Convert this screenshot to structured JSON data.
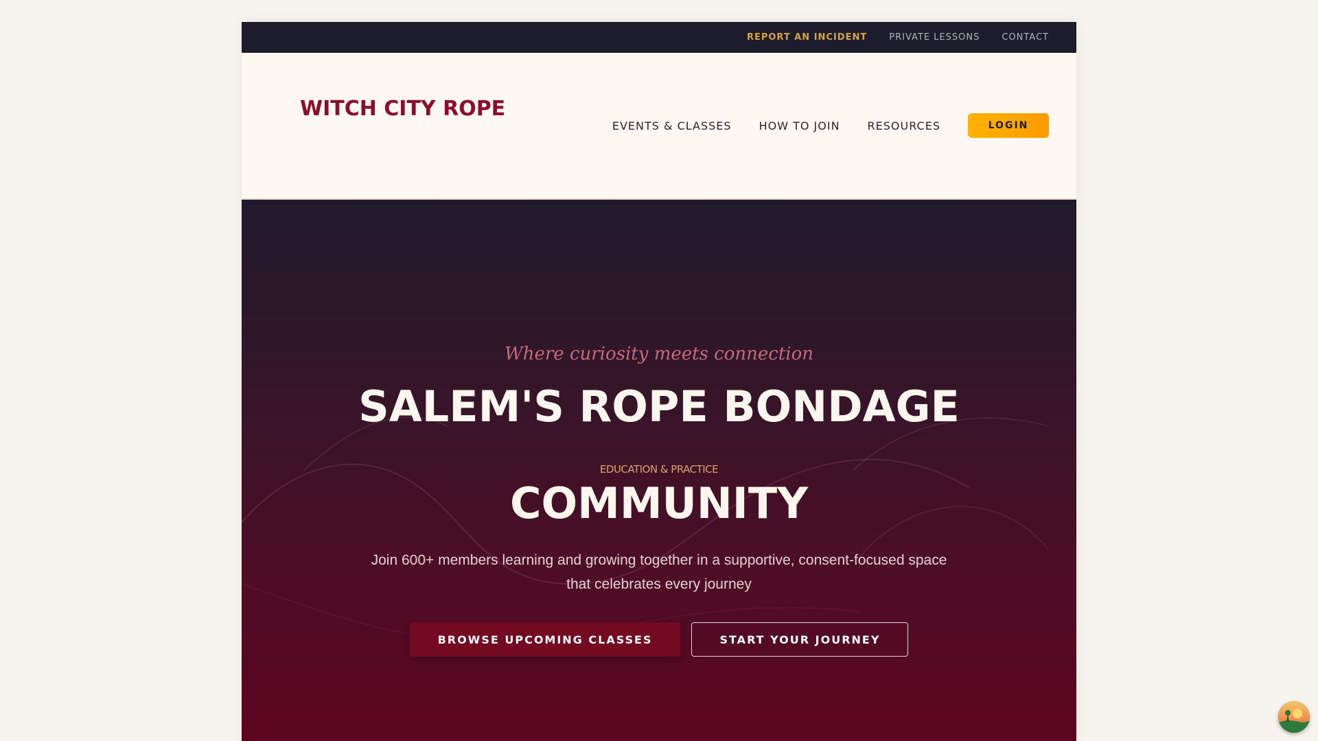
{
  "utility_nav": {
    "items": [
      "REPORT AN INCIDENT",
      "PRIVATE LESSONS",
      "CONTACT"
    ]
  },
  "header": {
    "logo": "WITCH CITY ROPE",
    "nav": [
      "EVENTS & CLASSES",
      "HOW TO JOIN",
      "RESOURCES"
    ],
    "login_label": "LOGIN"
  },
  "hero": {
    "tagline": "Where curiosity meets connection",
    "title_line_1": "SALEM'S ROPE BONDAGE",
    "subtitle": "EDUCATION & PRACTICE",
    "title_line_2": "COMMUNITY",
    "description": "Join 600+ members learning and growing together in a supportive, consent-focused space that celebrates every journey",
    "primary_cta": "BROWSE UPCOMING CLASSES",
    "secondary_cta": "START YOUR JOURNEY"
  },
  "colors": {
    "brand": "#8b0f2a",
    "accent": "#ffb300",
    "utility_bar": "#1c1c2c",
    "alert_link": "#d9a441"
  },
  "icons": {
    "floating_badge": "sunset-landscape-icon"
  }
}
